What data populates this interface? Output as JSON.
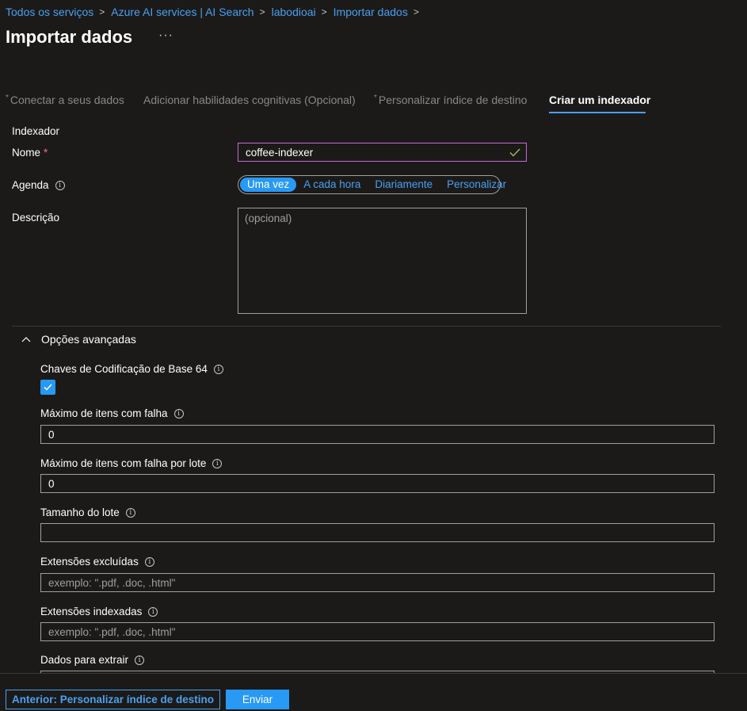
{
  "breadcrumb": [
    "Todos os serviços",
    "Azure AI services | AI Search",
    "labodioai",
    "Importar dados"
  ],
  "page_title": "Importar dados",
  "more_label": "···",
  "tabs": [
    {
      "label": "Conectar a seus dados",
      "required": "*"
    },
    {
      "label": "Adicionar habilidades cognitivas (Opcional)",
      "required": ""
    },
    {
      "label": "Personalizar índice de destino",
      "required": "*"
    },
    {
      "label": "Criar um indexador",
      "required": ""
    }
  ],
  "section_title": "Indexador",
  "form": {
    "name_label": "Nome",
    "name_required": "*",
    "name_value": "coffee-indexer",
    "schedule_label": "Agenda",
    "schedule_options": [
      "Uma vez",
      "A cada hora",
      "Diariamente",
      "Personalizar"
    ],
    "schedule_selected": "Uma vez",
    "description_label": "Descrição",
    "description_placeholder": "(opcional)"
  },
  "advanced": {
    "toggle_label": "Opções avançadas",
    "base64_label": "Chaves de Codificação de Base 64",
    "base64_checked": true,
    "max_failed_label": "Máximo de itens com falha",
    "max_failed_value": "0",
    "max_failed_batch_label": "Máximo de itens com falha por lote",
    "max_failed_batch_value": "0",
    "batch_size_label": "Tamanho do lote",
    "batch_size_value": "",
    "excluded_ext_label": "Extensões excluídas",
    "excluded_ext_placeholder": "exemplo: \".pdf, .doc, .html\"",
    "indexed_ext_label": "Extensões indexadas",
    "indexed_ext_placeholder": "exemplo: \".pdf, .doc, .html\"",
    "data_extract_label": "Dados para extrair"
  },
  "footer": {
    "prev_label": "Anterior: Personalizar índice de destino",
    "submit_label": "Enviar"
  },
  "colors": {
    "accent": "#2899f5",
    "link": "#4aa0f0",
    "background": "#1b1a19",
    "focus_border": "#c76bd0",
    "required": "#f1707b"
  }
}
